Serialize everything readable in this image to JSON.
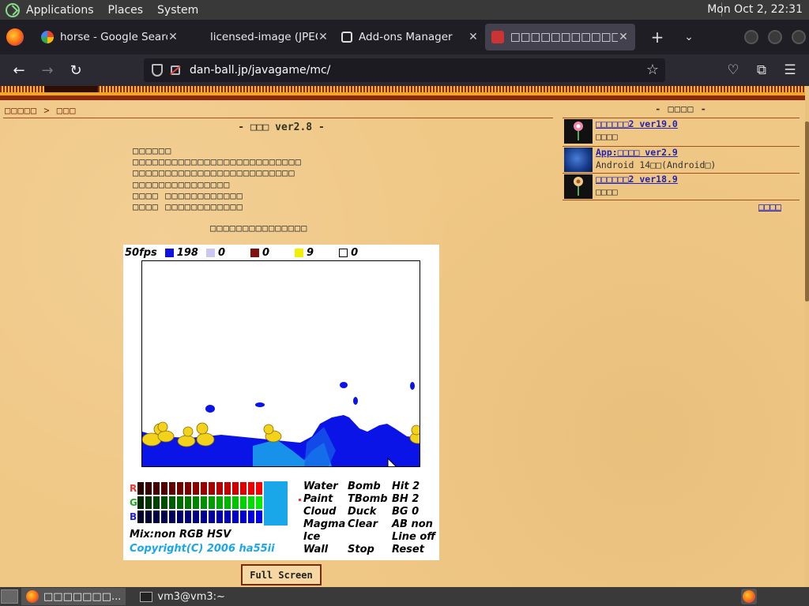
{
  "top_panel": {
    "menus": [
      "Applications",
      "Places",
      "System"
    ],
    "clock": "Mon Oct  2, 22:31"
  },
  "browser": {
    "tabs": [
      {
        "title": "horse - Google Search",
        "favicon": "google-icon",
        "active": false
      },
      {
        "title": "licensed-image (JPEG Ima",
        "favicon": "none",
        "active": false
      },
      {
        "title": "Add-ons Manager",
        "favicon": "puzzle-icon",
        "active": false
      },
      {
        "title": "□□□□□□□□□□□",
        "favicon": "dan-ball-icon",
        "active": true
      }
    ],
    "url": "dan-ball.jp/javagame/mc/"
  },
  "page": {
    "breadcrumb": "□□□□□ > □□□",
    "title": "- □□□ ver2.8 -",
    "intro_lines": [
      "□□□□□□",
      "□□□□□□□□□□□□□□□□□□□□□□□□□□",
      "□□□□□□□□□□□□□□□□□□□□□□□□□",
      "□□□□□□□□□□□□□□□",
      "□□□□ □□□□□□□□□□□□",
      "□□□□ □□□□□□□□□□□□"
    ],
    "subtitle": "□□□□□□□□□□□□□□□",
    "fullscreen_label": "Full Screen",
    "sidebar": {
      "header": "- □□□□ -",
      "items": [
        {
          "title": "□□□□□□2 ver19.0",
          "sub": "□□□□"
        },
        {
          "title": "App:□□□□ ver2.9",
          "sub": "Android 14□□(Android□)"
        },
        {
          "title": "□□□□□□2 ver18.9",
          "sub": "□□□□"
        }
      ],
      "more": "□□□□"
    }
  },
  "game": {
    "hud": {
      "fps": "50fps",
      "counts": [
        {
          "color": "#1010e0",
          "value": "198"
        },
        {
          "color": "#c8c8f0",
          "value": "0"
        },
        {
          "color": "#801010",
          "value": "0"
        },
        {
          "color": "#f0f000",
          "value": "9"
        },
        {
          "color": "#ffffff",
          "value": "0"
        }
      ]
    },
    "rgb_labels": [
      "R",
      "G",
      "B"
    ],
    "mix_line": "Mix:non RGB HSV",
    "copyright": "Copyright(C) 2006 ha55ii",
    "controls": [
      "Water",
      "Bomb",
      "Hit 2",
      "Paint",
      "TBomb",
      "BH 2",
      "Cloud",
      "Duck",
      "BG 0",
      "Magma",
      "Clear",
      "AB non",
      "Ice",
      "",
      "Line off",
      "Wall",
      "Stop",
      "Reset"
    ],
    "colors": {
      "water": "#0a14e6",
      "light_water": "#1aa7ea",
      "duck": "#f2d21a"
    }
  },
  "taskbar": {
    "items": [
      {
        "label": "□□□□□□□...",
        "icon": "firefox-icon"
      },
      {
        "label": "vm3@vm3:~",
        "icon": "terminal-icon"
      }
    ]
  }
}
